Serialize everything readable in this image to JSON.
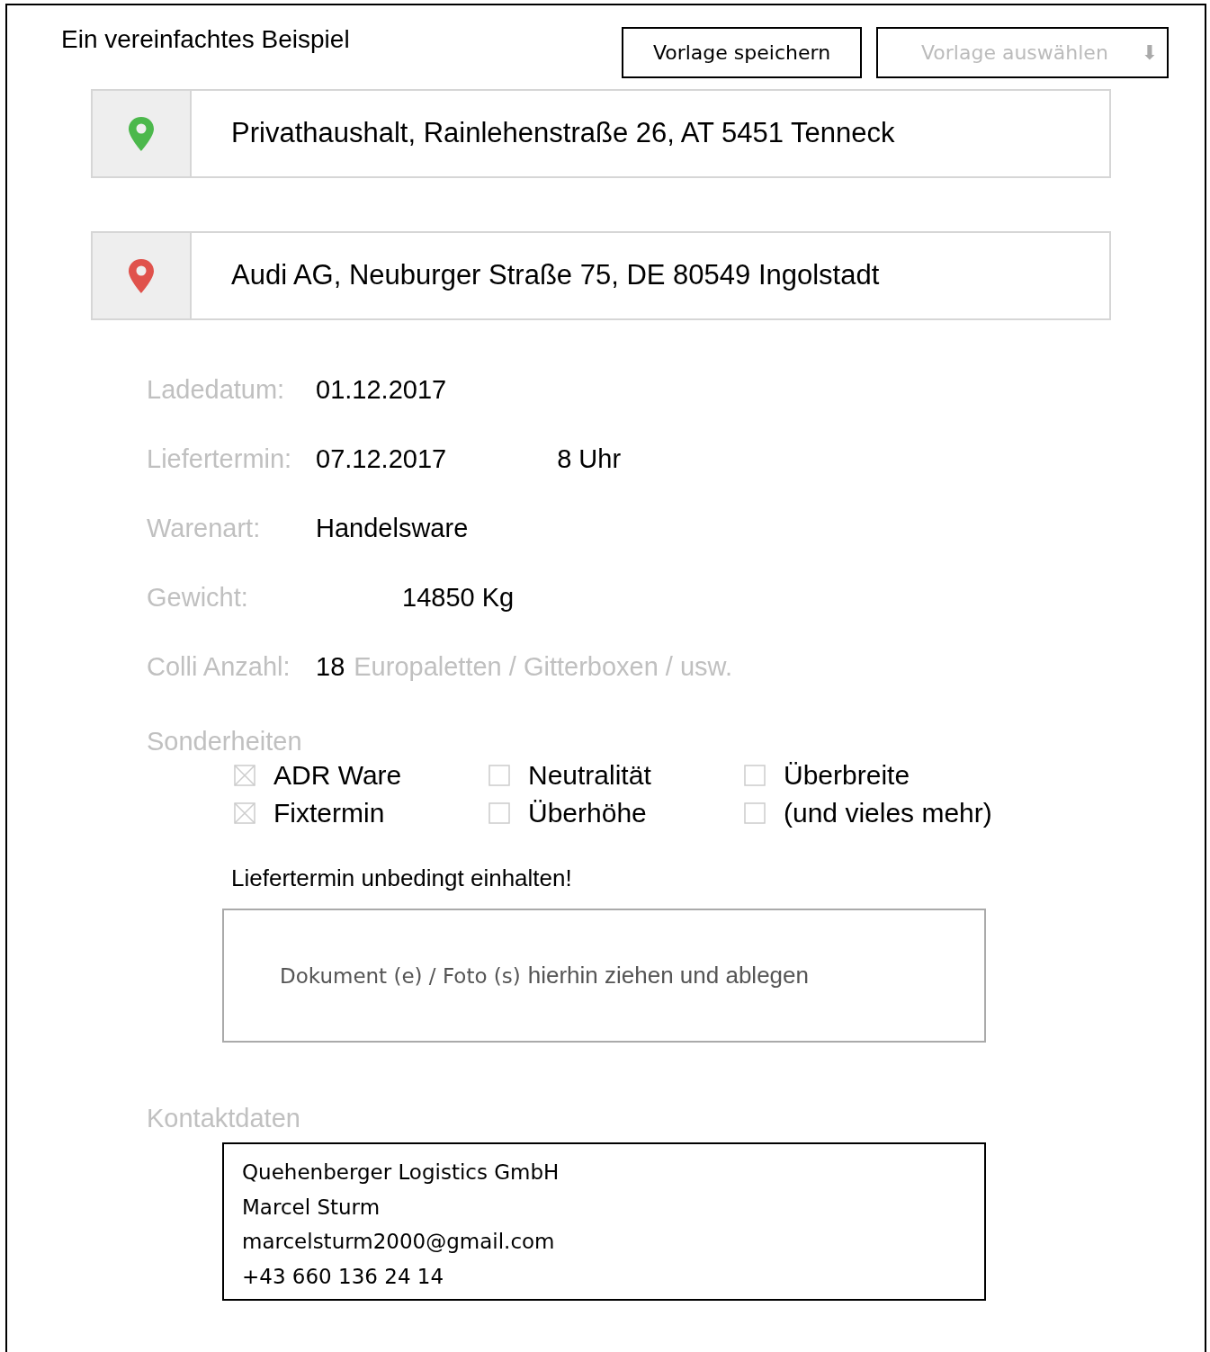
{
  "title": "Ein vereinfachtes Beispiel",
  "buttons": {
    "save": "Vorlage speichern",
    "select": "Vorlage auswählen",
    "select_arrow": "⬇"
  },
  "locations": [
    {
      "text": "Privathaushalt, Rainlehenstraße 26, AT 5451 Tenneck",
      "color": "#4cb84c"
    },
    {
      "text": "Audi AG, Neuburger Straße 75, DE 80549 Ingolstadt",
      "color": "#e0524c"
    }
  ],
  "fields": [
    {
      "kind": "plain",
      "label": "Ladedatum:",
      "value": "01.12.2017"
    },
    {
      "kind": "time",
      "label": "Liefertermin:",
      "value": "07.12.2017",
      "extra": "8 Uhr"
    },
    {
      "kind": "plain",
      "label": "Warenart:",
      "value": "Handelsware"
    },
    {
      "kind": "offset",
      "label": "Gewicht:",
      "value": "14850 Kg"
    },
    {
      "kind": "count",
      "label": "Colli Anzahl:",
      "value": "18",
      "extra": "Europaletten / Gitterboxen / usw."
    }
  ],
  "special": {
    "heading": "Sonderheiten",
    "options": [
      {
        "label": "ADR Ware",
        "checked": true
      },
      {
        "label": "Neutralität",
        "checked": false
      },
      {
        "label": "Überbreite",
        "checked": false
      },
      {
        "label": "Fixtermin",
        "checked": true
      },
      {
        "label": "Überhöhe",
        "checked": false
      },
      {
        "label": "(und vieles mehr)",
        "checked": false
      }
    ]
  },
  "note": "Liefertermin unbedingt einhalten!",
  "dropzone": {
    "text": "Dokument (e) / Foto (s)",
    "hint": "hierhin ziehen und ablegen"
  },
  "contact": {
    "heading": "Kontaktdaten",
    "lines": [
      "Quehenberger Logistics GmbH",
      "Marcel Sturm",
      "marcelsturm2000@gmail.com",
      "+43 660 136 24 14"
    ]
  }
}
